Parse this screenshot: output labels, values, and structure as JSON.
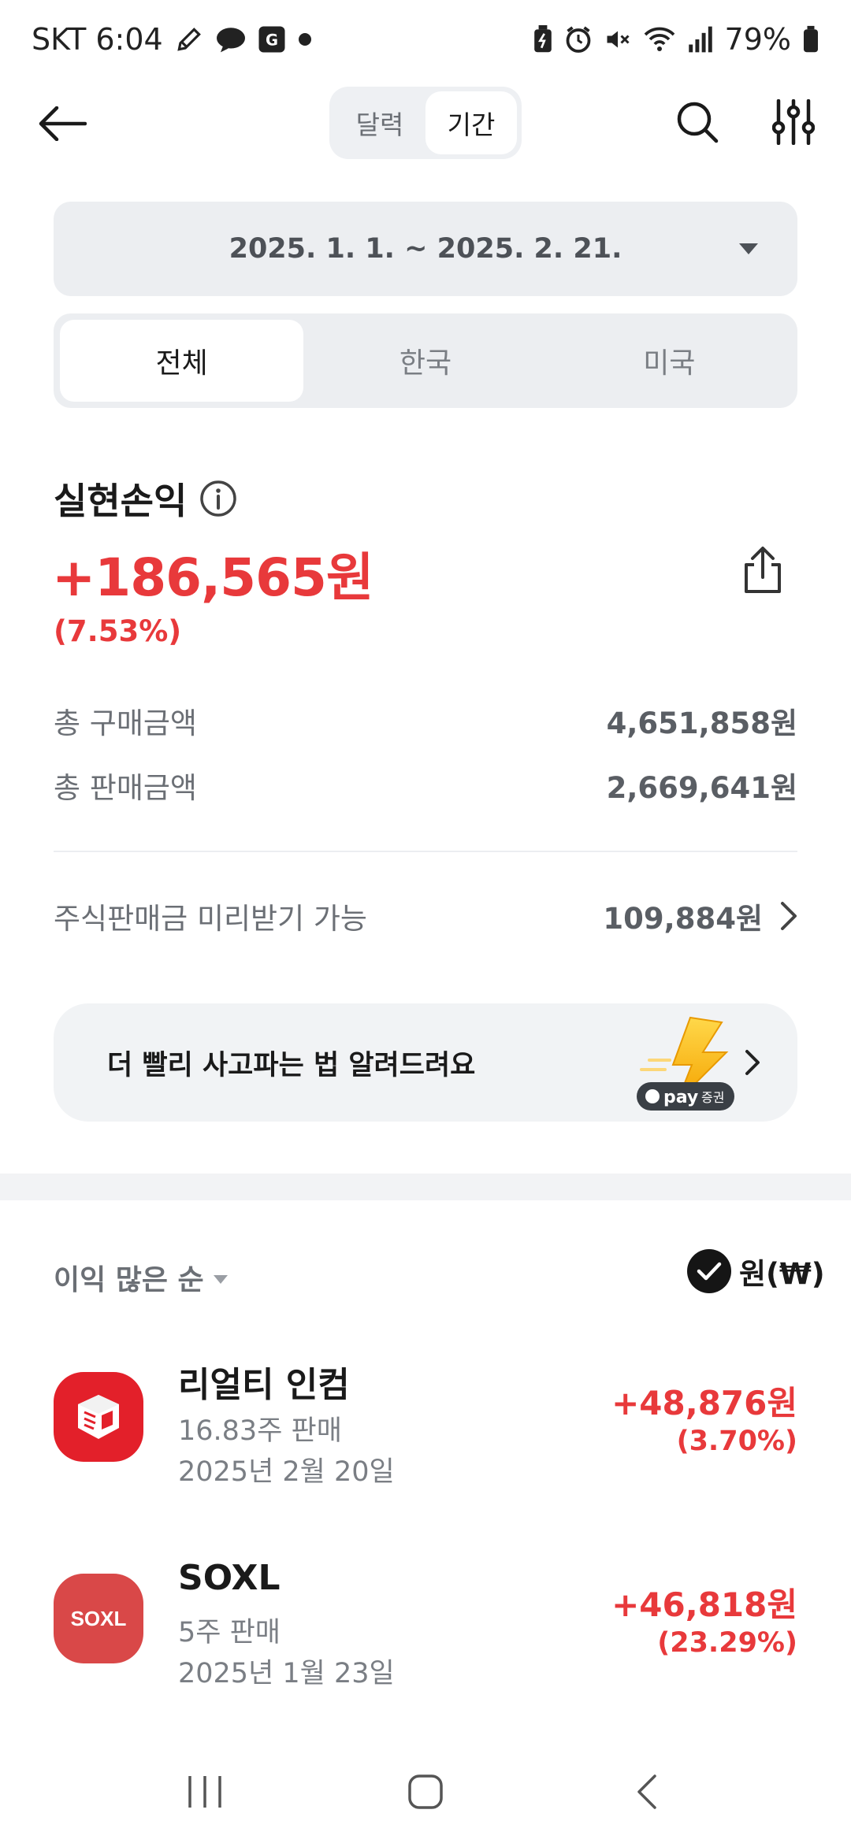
{
  "status_bar": {
    "carrier_time": "SKT 6:04",
    "battery": "79%",
    "icons_left": [
      "pencil-icon",
      "chat-bubble-icon",
      "app-badge-icon",
      "dot-icon"
    ],
    "icons_right": [
      "battery-saver-icon",
      "alarm-icon",
      "mute-icon",
      "wifi-icon",
      "signal-icon",
      "battery-icon"
    ]
  },
  "header": {
    "toggle": [
      {
        "label": "달력",
        "active": false
      },
      {
        "label": "기간",
        "active": true
      }
    ]
  },
  "date_range": "2025. 1. 1. ~ 2025. 2. 21.",
  "market_tabs": [
    {
      "label": "전체",
      "active": true
    },
    {
      "label": "한국",
      "active": false
    },
    {
      "label": "미국",
      "active": false
    }
  ],
  "summary": {
    "title": "실현손익",
    "profit": "+186,565원",
    "rate": "(7.53%)",
    "total_buy_label": "총 구매금액",
    "total_buy_value": "4,651,858원",
    "total_sell_label": "총 판매금액",
    "total_sell_value": "2,669,641원",
    "advance_label": "주식판매금 미리받기 가능",
    "advance_value": "109,884원"
  },
  "banner": {
    "text": "더 빨리 사고파는 법 알려드려요",
    "brand": "pay",
    "brand_sub": "증권"
  },
  "list": {
    "sort_label": "이익 많은 순",
    "currency_label": "원(₩)",
    "items": [
      {
        "name": "리얼티 인컴",
        "shares": "16.83주 판매",
        "date": "2025년 2월 20일",
        "profit": "+48,876원",
        "rate": "(3.70%)",
        "logo_text": "",
        "logo_color": "#e3202a"
      },
      {
        "name": "SOXL",
        "shares": "5주 판매",
        "date": "2025년 1월 23일",
        "profit": "+46,818원",
        "rate": "(23.29%)",
        "logo_text": "SOXL",
        "logo_color": "#d94848"
      }
    ]
  },
  "colors": {
    "accent_red": "#e8393b",
    "surface": "#eceef1",
    "text_muted": "#6b6f75"
  }
}
